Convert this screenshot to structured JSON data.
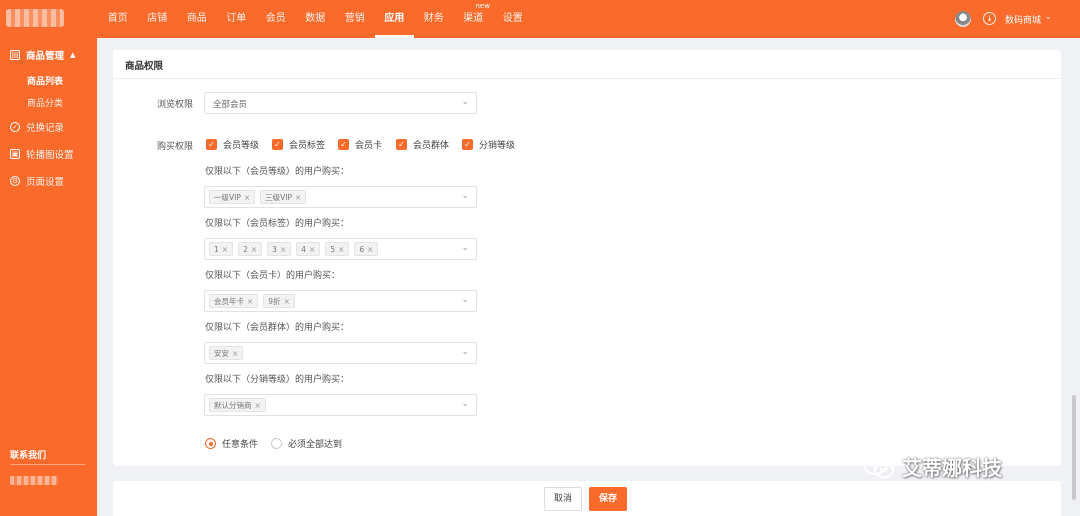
{
  "topnav": {
    "items": [
      "首页",
      "店铺",
      "商品",
      "订单",
      "会员",
      "数据",
      "营销",
      "应用",
      "财务",
      "渠道",
      "设置"
    ],
    "active_index": 7,
    "new_badge": "new",
    "shop_name": "数码商城"
  },
  "sidebar": {
    "group": "商品管理",
    "sub_items": [
      "商品列表",
      "商品分类"
    ],
    "active_sub": "商品列表",
    "items": [
      "兑换记录",
      "轮播图设置",
      "页面设置"
    ],
    "contact": "联系我们"
  },
  "card": {
    "title": "商品权限",
    "browse_label": "浏览权限",
    "browse_value": "全部会员",
    "buy_label": "购买权限",
    "checkboxes": [
      "会员等级",
      "会员标签",
      "会员卡",
      "会员群体",
      "分销等级"
    ],
    "groups": [
      {
        "hint": "仅限以下（会员等级）的用户购买：",
        "tags": [
          "一级VIP",
          "三级VIP"
        ]
      },
      {
        "hint": "仅限以下（会员标签）的用户购买：",
        "tags": [
          "1",
          "2",
          "3",
          "4",
          "5",
          "6"
        ]
      },
      {
        "hint": "仅限以下（会员卡）的用户购买：",
        "tags": [
          "会员年卡",
          "9折"
        ]
      },
      {
        "hint": "仅限以下（会员群体）的用户购买：",
        "tags": [
          "安安"
        ]
      },
      {
        "hint": "仅限以下（分销等级）的用户购买：",
        "tags": [
          "默认分销商"
        ]
      }
    ],
    "radio_any": "任意条件",
    "radio_all": "必须全部达到",
    "radio_selected": "任意条件"
  },
  "footer": {
    "cancel": "取消",
    "save": "保存"
  },
  "watermark": "艾蒂娜科技",
  "colors": {
    "brand": "#fa6a2a",
    "background": "#f0f1f5"
  }
}
